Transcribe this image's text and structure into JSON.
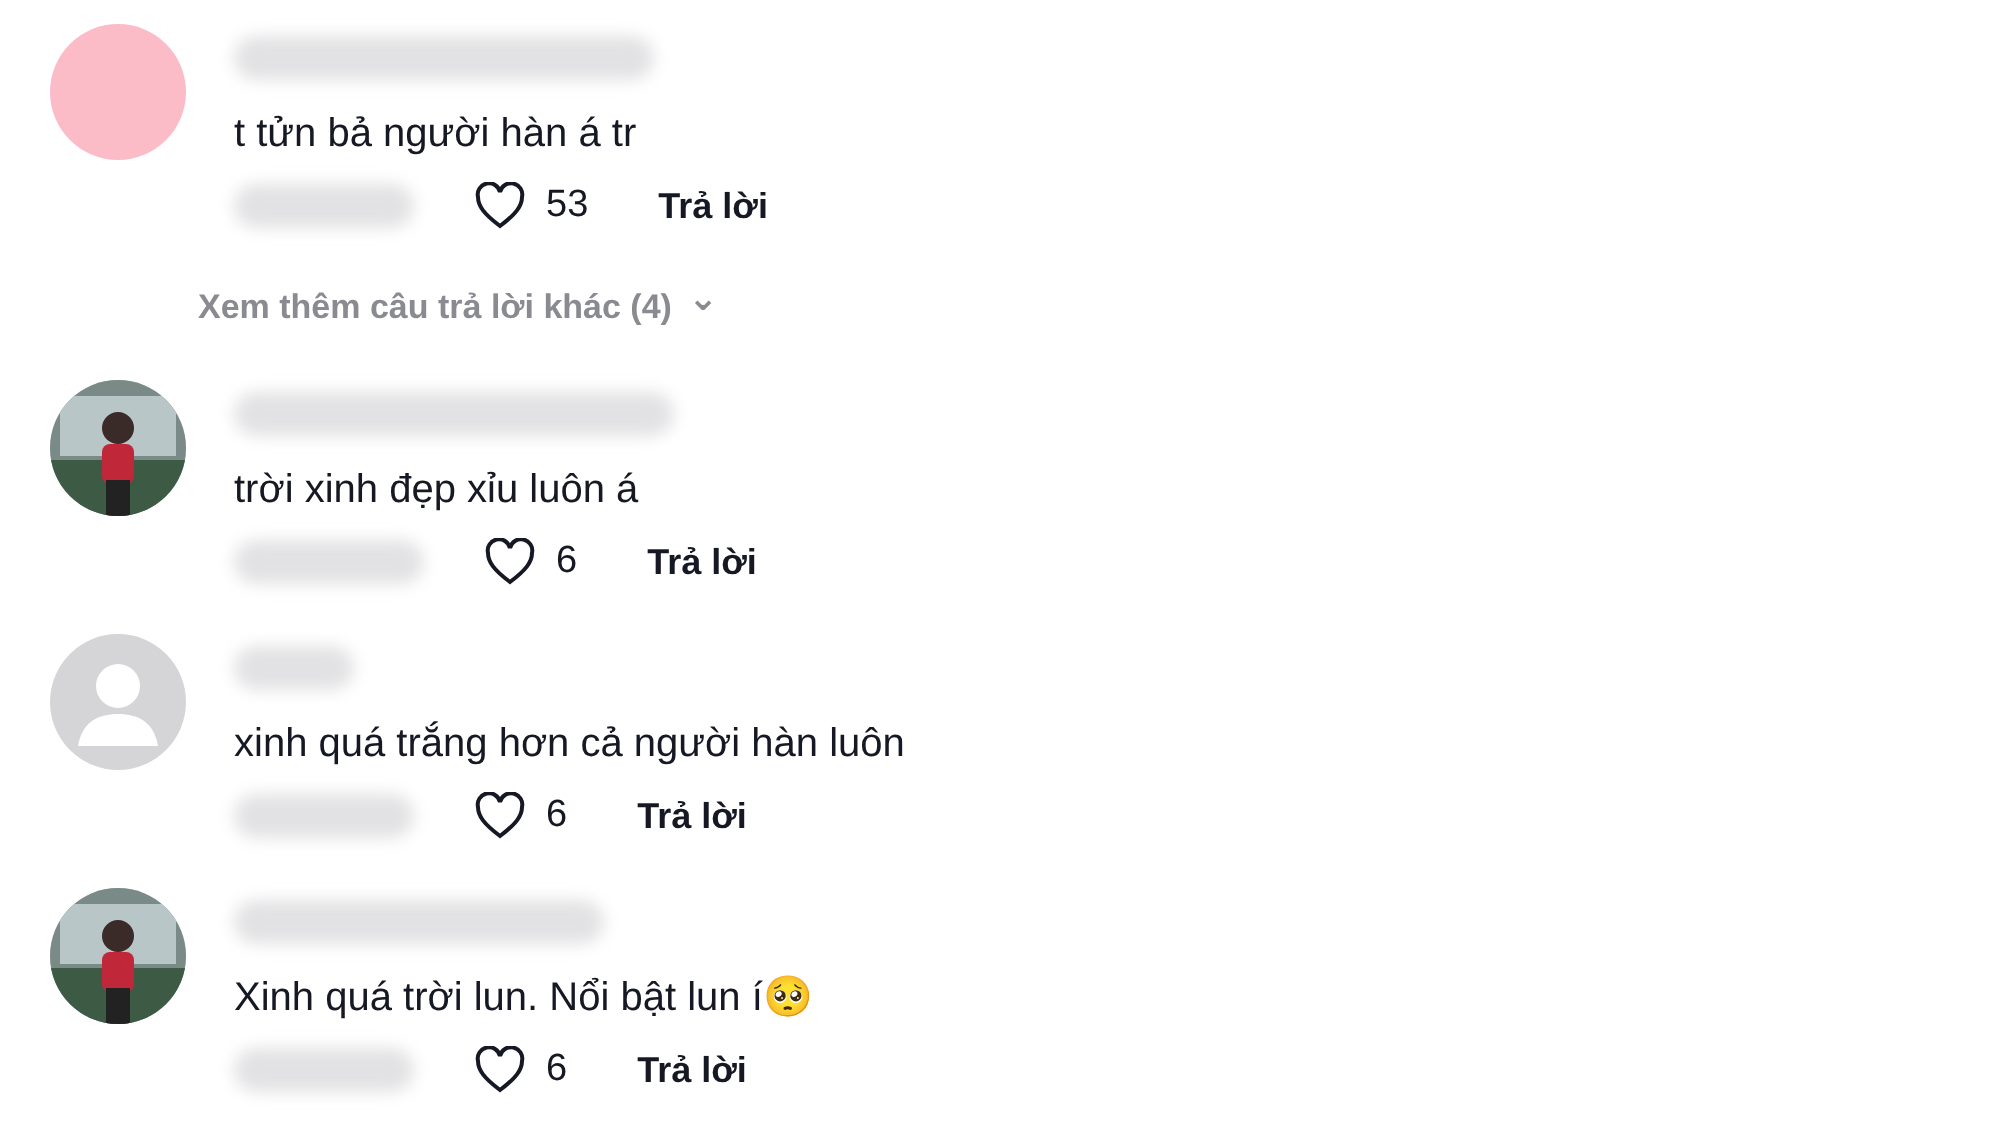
{
  "comments": [
    {
      "avatar": {
        "kind": "plain",
        "color": "#fbbcc8"
      },
      "text": "t tửn bả người hàn á tr",
      "likes": "53",
      "liked": false,
      "reply": "Trả lời",
      "more": {
        "label": "Xem thêm câu trả lời khác (4)",
        "caret": "⌄"
      }
    },
    {
      "text": "trời xinh đẹp xỉu luôn á",
      "likes": "6",
      "liked": false,
      "reply": "Trả lời"
    },
    {
      "avatar": {
        "kind": "default"
      },
      "text": "xinh quá trắng hơn cả người hàn luôn",
      "likes": "6",
      "liked": false,
      "reply": "Trả lời"
    },
    {
      "text": "Xinh quá trời lun. Nổi bật lun í🥺",
      "likes": "6",
      "liked": false,
      "reply": "Trả lời"
    }
  ]
}
